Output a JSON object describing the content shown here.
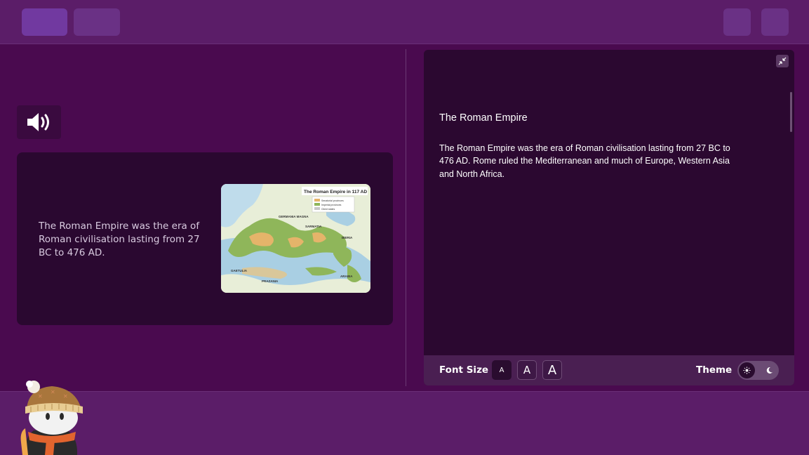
{
  "topbar": {},
  "slide": {
    "text": "The Roman Empire was the era of Roman civilisation lasting from 27 BC to 476 AD.",
    "map": {
      "title": "The Roman Empire in 117 AD",
      "legend": [
        "Senatorial provinces",
        "Imperial provinces",
        "Client states"
      ],
      "labels": [
        "GERMANIA MAGNA",
        "SARMATIA",
        "IBERIA",
        "GAETULIA",
        "ARABIA",
        "PRAZANIA"
      ]
    }
  },
  "reader": {
    "title": "The Roman Empire",
    "body": "The Roman Empire was the era of Roman civilisation lasting from 27 BC to 476 AD. Rome ruled the Mediterranean and much of Europe, Western Asia and North Africa.",
    "font_size_label": "Font Size",
    "font_small": "A",
    "font_medium": "A",
    "font_large": "A",
    "theme_label": "Theme",
    "theme_selected": "light"
  },
  "icons": {
    "audio": "speaker-icon",
    "collapse": "collapse-icon",
    "sun": "sun-icon",
    "moon": "moon-icon"
  },
  "colors": {
    "background": "#4a0a4f",
    "bar": "#5b1d68",
    "card": "#2a0830",
    "accent": "#7139a0"
  }
}
